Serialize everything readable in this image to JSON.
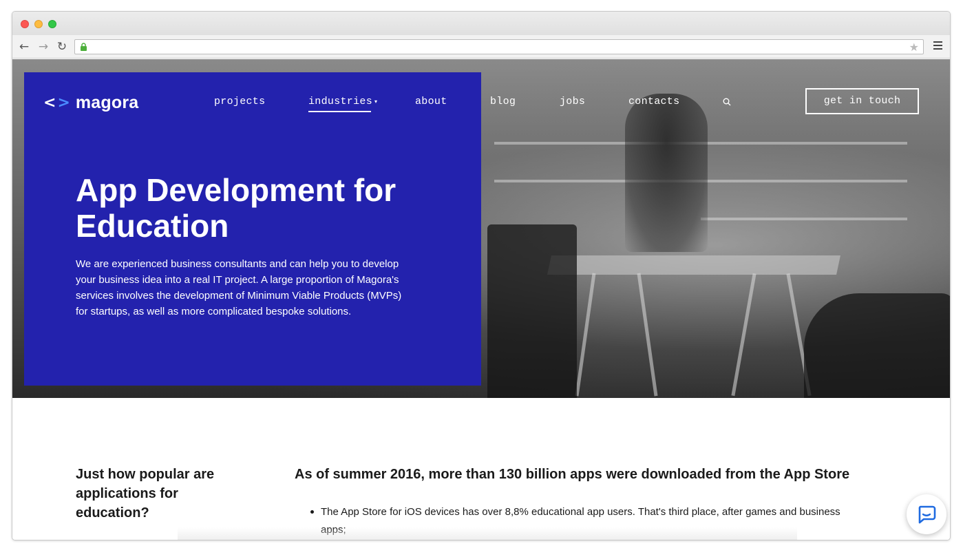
{
  "browser": {
    "url": "",
    "back_glyph": "←",
    "forward_glyph": "→",
    "reload_glyph": "↻",
    "star_glyph": "★"
  },
  "site": {
    "logo": {
      "text": "magora",
      "mark_lt": "<",
      "mark_gt": ">"
    },
    "nav": {
      "projects": "projects",
      "industries": "industries",
      "industries_caret": "▾",
      "about": "about",
      "blog": "blog",
      "jobs": "jobs",
      "contacts": "contacts"
    },
    "cta": "get in touch",
    "icons": {
      "search": "search-icon",
      "chat": "chat-icon"
    }
  },
  "hero": {
    "title": "App Development for Education",
    "description": "We are experienced business consultants and can help you to develop your business idea into a real IT project. A large proportion of Magora's services involves the development of Minimum Viable Products (MVPs) for startups, as well as more complicated bespoke solutions."
  },
  "content": {
    "side_heading": "Just how popular are applications for education?",
    "main_heading": "As of summer 2016, more than 130 billion apps were downloaded from the App Store",
    "bullets": [
      "The App Store for iOS devices has over 8,8% educational app users. That's third place, after games and business apps;"
    ]
  },
  "colors": {
    "panel_blue": "#2322ad",
    "logo_accent": "#4a8cff",
    "chat_blue": "#1e6ae0"
  }
}
